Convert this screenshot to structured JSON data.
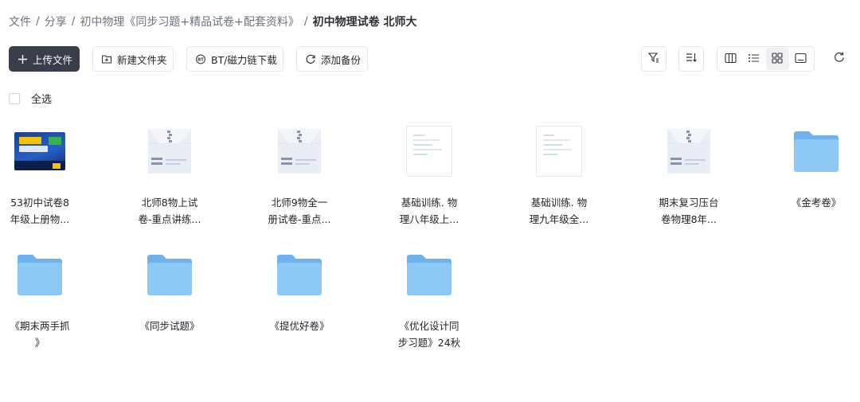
{
  "breadcrumb": {
    "items": [
      "文件",
      "分享",
      "初中物理《同步习题+精品试卷+配套资料》"
    ],
    "current": "初中物理试卷 北师大",
    "separator": "/"
  },
  "toolbar": {
    "upload_label": "上传文件",
    "new_folder_label": "新建文件夹",
    "bt_download_label": "BT/磁力链下载",
    "add_backup_label": "添加备份"
  },
  "select_all_label": "全选",
  "colors": {
    "primary_button": "#3a3d4c",
    "folder": "#8ec8f5",
    "archive": "#e9edf6"
  },
  "items": [
    {
      "type": "book-image",
      "icon": "book-cover-thumbnail",
      "name_lines": [
        "53初中试卷8",
        "年级上册物..."
      ]
    },
    {
      "type": "archive",
      "icon": "zip-archive-icon",
      "name_lines": [
        "北师8物上试",
        "卷-重点讲练..."
      ]
    },
    {
      "type": "archive",
      "icon": "zip-archive-icon",
      "name_lines": [
        "北师9物全一",
        "册试卷-重点..."
      ]
    },
    {
      "type": "document",
      "icon": "document-thumbnail",
      "name_lines": [
        "基础训练. 物",
        "理八年级上..."
      ]
    },
    {
      "type": "document",
      "icon": "document-thumbnail",
      "name_lines": [
        "基础训练. 物",
        "理九年级全..."
      ]
    },
    {
      "type": "archive",
      "icon": "zip-archive-icon",
      "name_lines": [
        "期末复习压台",
        "卷物理8年..."
      ]
    },
    {
      "type": "folder",
      "icon": "folder-icon",
      "name_lines": [
        "《金考卷》"
      ]
    },
    {
      "type": "folder",
      "icon": "folder-icon",
      "name_lines": [
        "《期末两手抓",
        "》"
      ]
    },
    {
      "type": "folder",
      "icon": "folder-icon",
      "name_lines": [
        "《同步试题》"
      ]
    },
    {
      "type": "folder",
      "icon": "folder-icon",
      "name_lines": [
        "《提优好卷》"
      ]
    },
    {
      "type": "folder",
      "icon": "folder-icon",
      "name_lines": [
        "《优化设计同",
        "步习题》24秋"
      ]
    }
  ]
}
